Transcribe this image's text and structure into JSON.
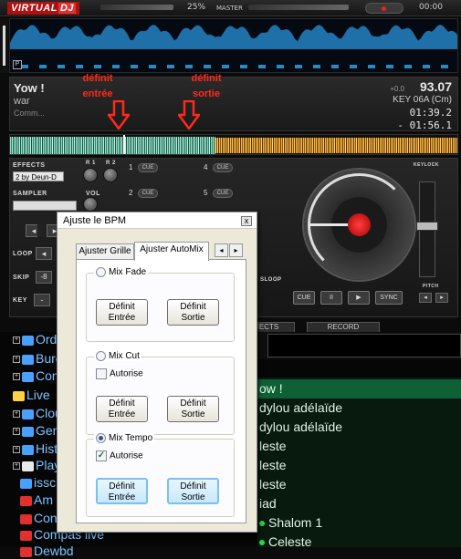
{
  "skin": {
    "logo": "VIRTUAL",
    "logo_dj": "DJ",
    "cpu_percent": "25%",
    "master_label": "MASTER",
    "clock": "00:00",
    "deck": {
      "title": "Yow !",
      "artist": "war",
      "comment": "Comm...",
      "pitch": "+0.0",
      "bpm": "93.07",
      "key": "KEY 06A (Cm)",
      "elapsed": "01:39.2",
      "remain": "- 01:56.1"
    },
    "annotations": {
      "entree": "définit\nentrée",
      "sortie": "définit\nsortie",
      "color": "#ff2a1a"
    },
    "effects_label": "EFFECTS",
    "effect_value": "2 by Deun-D",
    "sampler_label": "SAMPLER",
    "vol_label": "VOL",
    "loop_label": "LOOP",
    "skip_label": "SKIP",
    "skip_value": "-8",
    "key_label": "KEY",
    "keylock_label": "KEYLOCK",
    "pitch_label": "PITCH",
    "cue_label": "CUE",
    "sync_label": "SYNC",
    "effects_tab": "EFFECTS",
    "record_tab": "RECORD",
    "cue_numbers": [
      "1",
      "2",
      "4",
      "5"
    ],
    "r1": "R 1",
    "r2": "R 2",
    "sloop_label": "SLOOP"
  },
  "browser": {
    "tree": [
      {
        "label": "Ordi",
        "icon": "computer-icon",
        "color": "#4aa0ff"
      },
      {
        "label": "Bure",
        "icon": "desktop-icon",
        "color": "#4aa0ff"
      },
      {
        "label": "Con",
        "icon": "globe-icon",
        "color": "#4aa0ff"
      },
      {
        "label": "Live",
        "icon": "folder-icon",
        "color": "#ffd040"
      },
      {
        "label": "Clou",
        "icon": "cloud-icon",
        "color": "#4aa0ff"
      },
      {
        "label": "Gen",
        "icon": "genre-icon",
        "color": "#4aa0ff"
      },
      {
        "label": "Histo",
        "icon": "history-icon",
        "color": "#4aa0ff"
      },
      {
        "label": "Play",
        "icon": "playlist-icon",
        "color": "#e8e8e8"
      },
      {
        "label": "issc",
        "icon": "network-icon",
        "color": "#4aa0ff"
      },
      {
        "label": "Am",
        "icon": "folder-icon",
        "color": "#e03030"
      },
      {
        "label": "Con",
        "icon": "folder-icon",
        "color": "#e03030"
      },
      {
        "label": "Compas live",
        "icon": "folder-icon",
        "color": "#e03030"
      },
      {
        "label": "Dewbd",
        "icon": "folder-icon",
        "color": "#e03030"
      }
    ],
    "songs": [
      {
        "title": "ow !",
        "selected": true
      },
      {
        "title": "dylou adélaïde",
        "selected": false
      },
      {
        "title": "dylou adélaïde",
        "selected": false
      },
      {
        "title": "leste",
        "selected": false
      },
      {
        "title": "leste",
        "selected": false
      },
      {
        "title": "leste",
        "selected": false
      },
      {
        "title": "iad",
        "selected": false
      },
      {
        "title": "Shalom 1",
        "selected": false
      },
      {
        "title": "Celeste",
        "selected": false
      }
    ]
  },
  "dialog": {
    "title": "Ajuste le BPM",
    "close": "x",
    "tabs": [
      {
        "label": "Ajuster Grille",
        "active": false
      },
      {
        "label": "Ajuster AutoMix",
        "active": true
      }
    ],
    "tab_prev": "◂",
    "tab_next": "▸",
    "groups": [
      {
        "label": "Mix Fade",
        "radio_on": false,
        "has_checkbox": false,
        "btn_in": "Définit\nEntrée",
        "btn_out": "Définit\nSortie"
      },
      {
        "label": "Mix Cut",
        "radio_on": false,
        "has_checkbox": true,
        "checkbox_label": "Autorise",
        "checked": false,
        "btn_in": "Définit\nEntrée",
        "btn_out": "Définit\nSortie"
      },
      {
        "label": "Mix Tempo",
        "radio_on": true,
        "has_checkbox": true,
        "checkbox_label": "Autorise",
        "checked": true,
        "btn_in": "Définit\nEntrée",
        "btn_out": "Définit\nSortie"
      }
    ]
  }
}
